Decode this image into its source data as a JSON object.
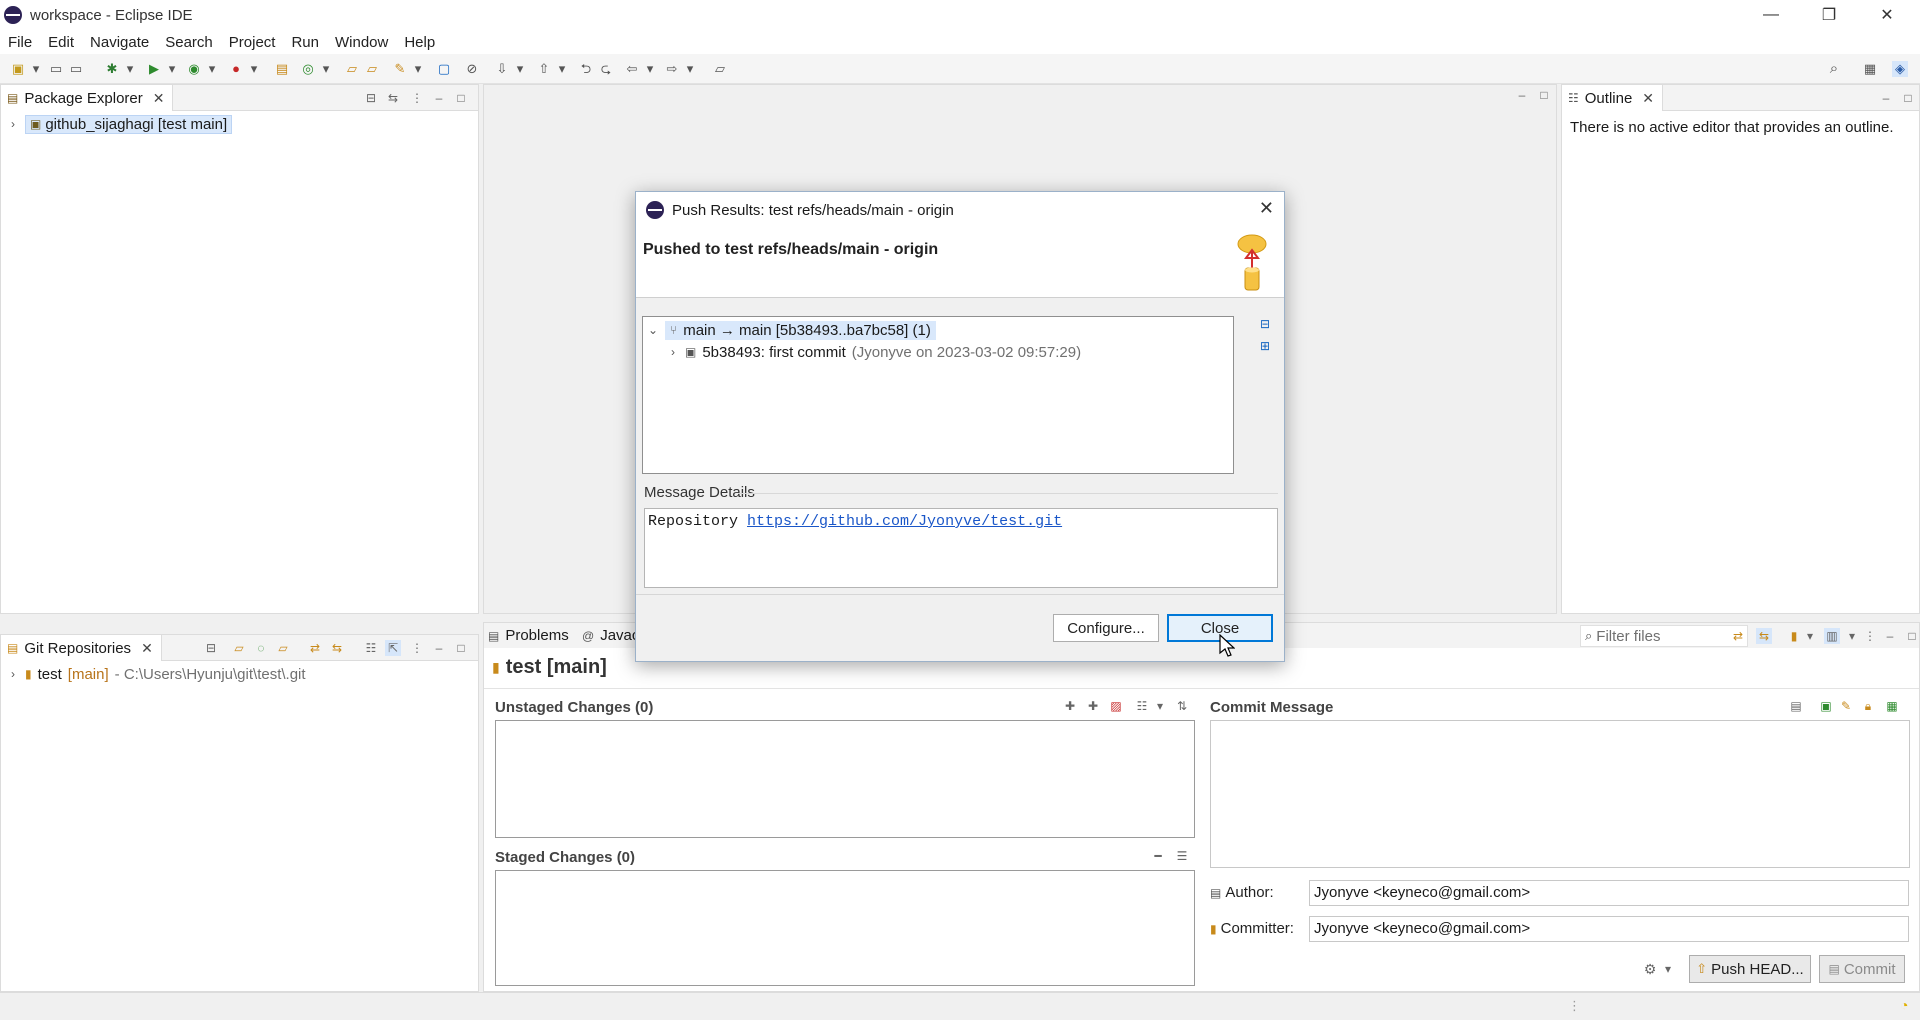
{
  "window": {
    "title": "workspace - Eclipse IDE"
  },
  "menu": [
    "File",
    "Edit",
    "Navigate",
    "Search",
    "Project",
    "Run",
    "Window",
    "Help"
  ],
  "package_explorer": {
    "tab": "Package Explorer",
    "project": "github_sijaghagi [test main]"
  },
  "outline": {
    "tab": "Outline",
    "message": "There is no active editor that provides an outline."
  },
  "git_repositories": {
    "tab": "Git Repositories",
    "repo_name": "test",
    "repo_branch": "[main]",
    "repo_path": "- C:\\Users\\Hyunju\\git\\test\\.git"
  },
  "bottom_tabs": {
    "problems": "Problems",
    "javadoc": "Javac"
  },
  "staging": {
    "filter_placeholder": "Filter files",
    "repo_title": "test [main]",
    "unstaged_title": "Unstaged Changes (0)",
    "staged_title": "Staged Changes (0)",
    "commit_message_title": "Commit Message",
    "author_label": "Author:",
    "author_value": "Jyonyve <keyneco@gmail.com>",
    "committer_label": "Committer:",
    "committer_value": "Jyonyve <keyneco@gmail.com>",
    "push_label": "Push HEAD...",
    "commit_label": "Commit"
  },
  "dialog": {
    "title": "Push Results: test refs/heads/main - origin",
    "header": "Pushed to test refs/heads/main - origin",
    "ref_row": "main → main [5b38493..ba7bc58] (1)",
    "commit_row": "5b38493: first commit",
    "commit_meta": "(Jyonyve on 2023-03-02 09:57:29)",
    "message_details_label": "Message Details",
    "repository_label": "Repository",
    "repository_url": "https://github.com/Jyonyve/test.git",
    "configure_label": "Configure...",
    "close_label": "Close"
  }
}
